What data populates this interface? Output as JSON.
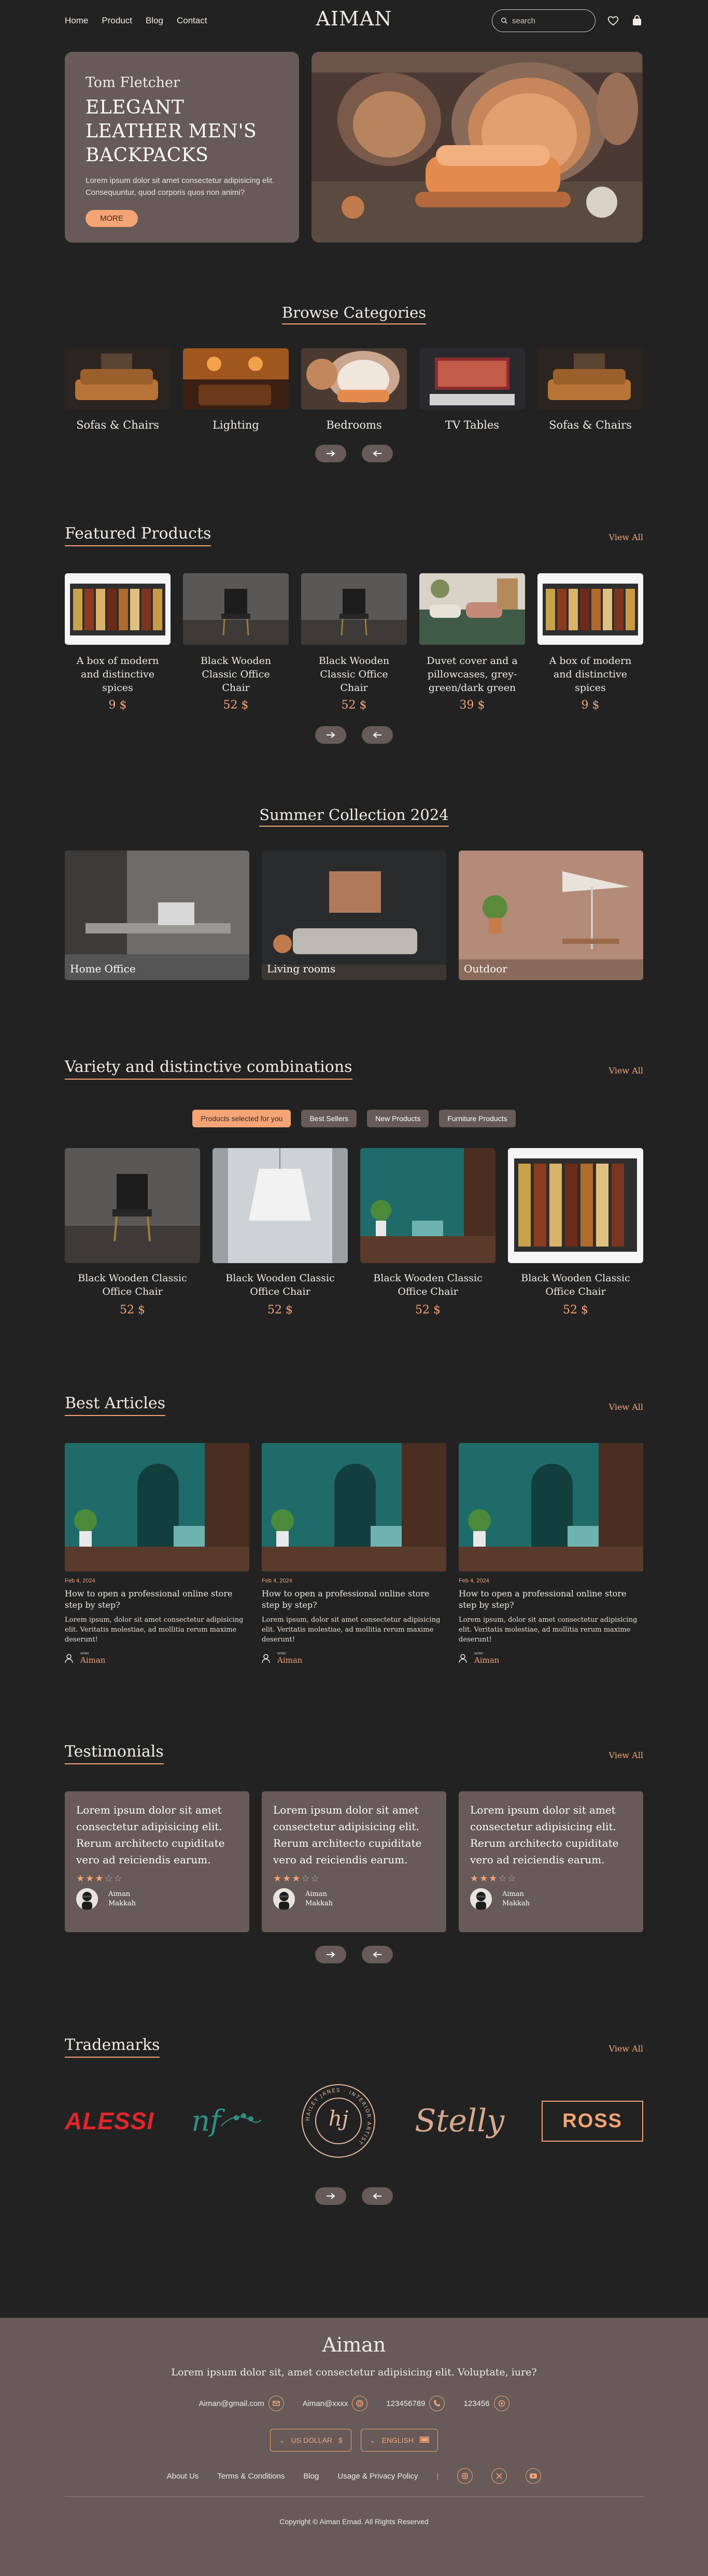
{
  "nav": {
    "links": [
      "Home",
      "Product",
      "Blog",
      "Contact"
    ],
    "brand": "AIMAN",
    "search_placeholder": "search"
  },
  "hero": {
    "name": "Tom Fletcher",
    "title": "ELEGANT LEATHER MEN'S BACKPACKS",
    "desc": "Lorem ipsum dolor sit amet consectetur adipisicing elit. Consequuntur, quod corporis quos non animi?",
    "cta": "MORE"
  },
  "categories": {
    "title": "Browse Categories",
    "items": [
      "Sofas & Chairs",
      "Lighting",
      "Bedrooms",
      "TV Tables",
      "Sofas & Chairs"
    ]
  },
  "featured": {
    "title": "Featured Products",
    "view_all": "View All",
    "items": [
      {
        "name": "A box of modern and distinctive spices",
        "price": "9 $"
      },
      {
        "name": "Black Wooden Classic Office Chair",
        "price": "52 $"
      },
      {
        "name": "Black Wooden Classic Office Chair",
        "price": "52 $"
      },
      {
        "name": "Duvet cover and a pillowcases, grey-green/dark green",
        "price": "39 $"
      },
      {
        "name": "A box of modern and distinctive spices",
        "price": "9 $"
      }
    ]
  },
  "summer": {
    "title": "Summer Collection 2024",
    "items": [
      "Home Office",
      "Living rooms",
      "Outdoor"
    ]
  },
  "variety": {
    "title": "Variety and distinctive combinations",
    "view_all": "View All",
    "chips": [
      "Products selected for you",
      "Best Sellers",
      "New Products",
      "Furniture Products"
    ],
    "items": [
      {
        "name": "Black Wooden Classic Office Chair",
        "price": "52 $"
      },
      {
        "name": "Black Wooden Classic Office Chair",
        "price": "52 $"
      },
      {
        "name": "Black Wooden Classic Office Chair",
        "price": "52 $"
      },
      {
        "name": "Black Wooden Classic Office Chair",
        "price": "52 $"
      }
    ]
  },
  "articles": {
    "title": "Best Articles",
    "view_all": "View All",
    "items": [
      {
        "date": "Feb 4, 2024",
        "title": "How to open a professional online store step by step?",
        "body": "Lorem ipsum, dolor sit amet consectetur adipisicing elit. Veritatis molestiae, ad mollitia rerum maxime deserunt!",
        "author_label": "writer",
        "author": "Aiman"
      },
      {
        "date": "Feb 4, 2024",
        "title": "How to open a professional online store step by step?",
        "body": "Lorem ipsum, dolor sit amet consectetur adipisicing elit. Veritatis molestiae, ad mollitia rerum maxime deserunt!",
        "author_label": "writer",
        "author": "Aiman"
      },
      {
        "date": "Feb 4, 2024",
        "title": "How to open a professional online store step by step?",
        "body": "Lorem ipsum, dolor sit amet consectetur adipisicing elit. Veritatis molestiae, ad mollitia rerum maxime deserunt!",
        "author_label": "writer",
        "author": "Aiman"
      }
    ]
  },
  "testimonials": {
    "title": "Testimonials",
    "view_all": "View All",
    "items": [
      {
        "quote": "Lorem ipsum dolor sit amet consectetur adipisicing elit. Rerum architecto cupiditate vero ad reiciendis earum.",
        "rating": 3,
        "name": "Aiman",
        "city": "Makkah"
      },
      {
        "quote": "Lorem ipsum dolor sit amet consectetur adipisicing elit. Rerum architecto cupiditate vero ad reiciendis earum.",
        "rating": 3,
        "name": "Aiman",
        "city": "Makkah"
      },
      {
        "quote": "Lorem ipsum dolor sit amet consectetur adipisicing elit. Rerum architecto cupiditate vero ad reiciendis earum.",
        "rating": 3,
        "name": "Aiman",
        "city": "Makkah"
      }
    ]
  },
  "trademarks": {
    "title": "Trademarks",
    "view_all": "View All",
    "logos": [
      "ALESSI",
      "nf",
      "hj",
      "Stelly",
      "ROSS"
    ],
    "seal_text": "HAILEY JANES · INTERIOR ARTIST"
  },
  "footer": {
    "title": "Aiman",
    "desc": "Lorem ipsum dolor sit, amet consectetur adipisicing elit. Voluptate, iure?",
    "email": "Aiman@gmail.com",
    "handle": "Aiman@xxxx",
    "phone1": "123456789",
    "phone2": "123456",
    "currency": "US DOLLAR",
    "currency_symbol": "$",
    "language": "ENGLISH",
    "links": [
      "About Us",
      "Terms & Conditions",
      "Blog",
      "Usage & Privacy Policy"
    ],
    "copyright": "Copyright © Aiman Emad. All Rights Reserved"
  },
  "colors": {
    "bg": "#222222",
    "card": "#675a58",
    "accent": "#f4a475"
  }
}
